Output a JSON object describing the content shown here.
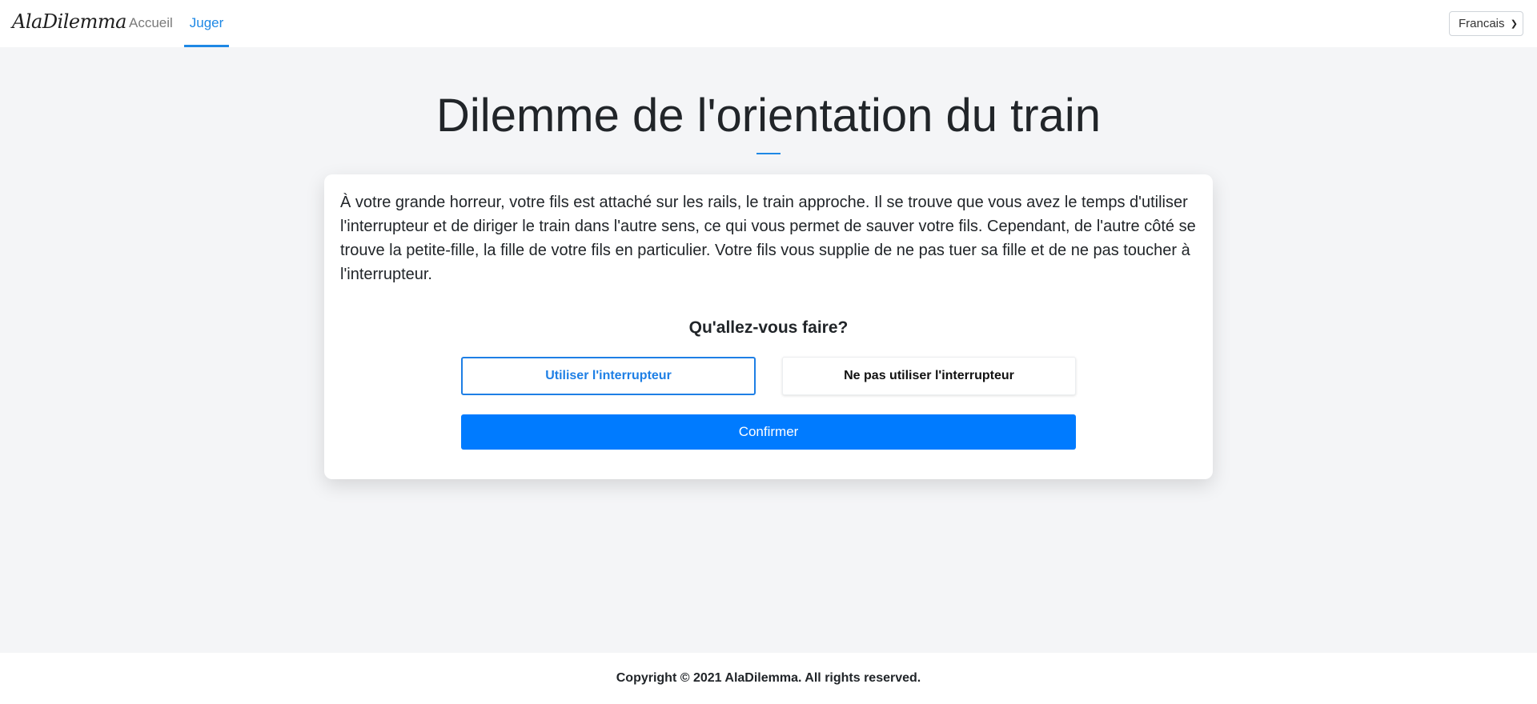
{
  "nav": {
    "brand": "AlaDilemma",
    "links": [
      {
        "label": "Accueil",
        "active": false
      },
      {
        "label": "Juger",
        "active": true
      }
    ],
    "language": {
      "selected": "Francais"
    }
  },
  "dilemma": {
    "title": "Dilemme de l'orientation du train",
    "story": "À votre grande horreur, votre fils est attaché sur les rails, le train approche. Il se trouve que vous avez le temps d'utiliser l'interrupteur et de diriger le train dans l'autre sens, ce qui vous permet de sauver votre fils. Cependant, de l'autre côté se trouve la petite-fille, la fille de votre fils en particulier. Votre fils vous supplie de ne pas tuer sa fille et de ne pas toucher à l'interrupteur.",
    "question": "Qu'allez-vous faire?",
    "choices": [
      {
        "label": "Utiliser l'interrupteur",
        "selected": true
      },
      {
        "label": "Ne pas utiliser l'interrupteur",
        "selected": false
      }
    ],
    "confirm_label": "Confirmer"
  },
  "footer": {
    "copyright": "Copyright © 2021 AlaDilemma. All rights reserved."
  },
  "colors": {
    "accent": "#1e88e5",
    "primary_button": "#007bff",
    "background": "#f4f5f7"
  }
}
